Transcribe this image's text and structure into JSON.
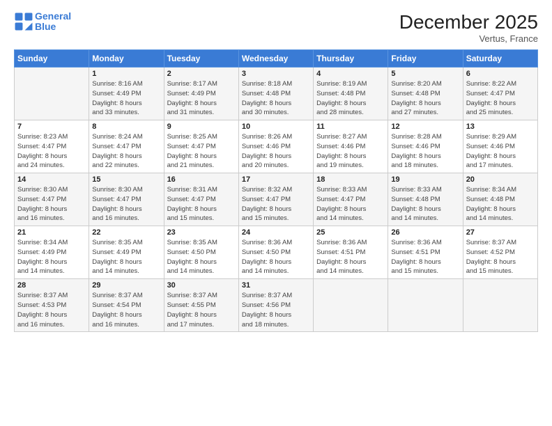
{
  "logo": {
    "line1": "General",
    "line2": "Blue"
  },
  "title": "December 2025",
  "location": "Vertus, France",
  "headers": [
    "Sunday",
    "Monday",
    "Tuesday",
    "Wednesday",
    "Thursday",
    "Friday",
    "Saturday"
  ],
  "weeks": [
    [
      {
        "day": "",
        "info": ""
      },
      {
        "day": "1",
        "info": "Sunrise: 8:16 AM\nSunset: 4:49 PM\nDaylight: 8 hours\nand 33 minutes."
      },
      {
        "day": "2",
        "info": "Sunrise: 8:17 AM\nSunset: 4:49 PM\nDaylight: 8 hours\nand 31 minutes."
      },
      {
        "day": "3",
        "info": "Sunrise: 8:18 AM\nSunset: 4:48 PM\nDaylight: 8 hours\nand 30 minutes."
      },
      {
        "day": "4",
        "info": "Sunrise: 8:19 AM\nSunset: 4:48 PM\nDaylight: 8 hours\nand 28 minutes."
      },
      {
        "day": "5",
        "info": "Sunrise: 8:20 AM\nSunset: 4:48 PM\nDaylight: 8 hours\nand 27 minutes."
      },
      {
        "day": "6",
        "info": "Sunrise: 8:22 AM\nSunset: 4:47 PM\nDaylight: 8 hours\nand 25 minutes."
      }
    ],
    [
      {
        "day": "7",
        "info": "Sunrise: 8:23 AM\nSunset: 4:47 PM\nDaylight: 8 hours\nand 24 minutes."
      },
      {
        "day": "8",
        "info": "Sunrise: 8:24 AM\nSunset: 4:47 PM\nDaylight: 8 hours\nand 22 minutes."
      },
      {
        "day": "9",
        "info": "Sunrise: 8:25 AM\nSunset: 4:47 PM\nDaylight: 8 hours\nand 21 minutes."
      },
      {
        "day": "10",
        "info": "Sunrise: 8:26 AM\nSunset: 4:46 PM\nDaylight: 8 hours\nand 20 minutes."
      },
      {
        "day": "11",
        "info": "Sunrise: 8:27 AM\nSunset: 4:46 PM\nDaylight: 8 hours\nand 19 minutes."
      },
      {
        "day": "12",
        "info": "Sunrise: 8:28 AM\nSunset: 4:46 PM\nDaylight: 8 hours\nand 18 minutes."
      },
      {
        "day": "13",
        "info": "Sunrise: 8:29 AM\nSunset: 4:46 PM\nDaylight: 8 hours\nand 17 minutes."
      }
    ],
    [
      {
        "day": "14",
        "info": "Sunrise: 8:30 AM\nSunset: 4:47 PM\nDaylight: 8 hours\nand 16 minutes."
      },
      {
        "day": "15",
        "info": "Sunrise: 8:30 AM\nSunset: 4:47 PM\nDaylight: 8 hours\nand 16 minutes."
      },
      {
        "day": "16",
        "info": "Sunrise: 8:31 AM\nSunset: 4:47 PM\nDaylight: 8 hours\nand 15 minutes."
      },
      {
        "day": "17",
        "info": "Sunrise: 8:32 AM\nSunset: 4:47 PM\nDaylight: 8 hours\nand 15 minutes."
      },
      {
        "day": "18",
        "info": "Sunrise: 8:33 AM\nSunset: 4:47 PM\nDaylight: 8 hours\nand 14 minutes."
      },
      {
        "day": "19",
        "info": "Sunrise: 8:33 AM\nSunset: 4:48 PM\nDaylight: 8 hours\nand 14 minutes."
      },
      {
        "day": "20",
        "info": "Sunrise: 8:34 AM\nSunset: 4:48 PM\nDaylight: 8 hours\nand 14 minutes."
      }
    ],
    [
      {
        "day": "21",
        "info": "Sunrise: 8:34 AM\nSunset: 4:49 PM\nDaylight: 8 hours\nand 14 minutes."
      },
      {
        "day": "22",
        "info": "Sunrise: 8:35 AM\nSunset: 4:49 PM\nDaylight: 8 hours\nand 14 minutes."
      },
      {
        "day": "23",
        "info": "Sunrise: 8:35 AM\nSunset: 4:50 PM\nDaylight: 8 hours\nand 14 minutes."
      },
      {
        "day": "24",
        "info": "Sunrise: 8:36 AM\nSunset: 4:50 PM\nDaylight: 8 hours\nand 14 minutes."
      },
      {
        "day": "25",
        "info": "Sunrise: 8:36 AM\nSunset: 4:51 PM\nDaylight: 8 hours\nand 14 minutes."
      },
      {
        "day": "26",
        "info": "Sunrise: 8:36 AM\nSunset: 4:51 PM\nDaylight: 8 hours\nand 15 minutes."
      },
      {
        "day": "27",
        "info": "Sunrise: 8:37 AM\nSunset: 4:52 PM\nDaylight: 8 hours\nand 15 minutes."
      }
    ],
    [
      {
        "day": "28",
        "info": "Sunrise: 8:37 AM\nSunset: 4:53 PM\nDaylight: 8 hours\nand 16 minutes."
      },
      {
        "day": "29",
        "info": "Sunrise: 8:37 AM\nSunset: 4:54 PM\nDaylight: 8 hours\nand 16 minutes."
      },
      {
        "day": "30",
        "info": "Sunrise: 8:37 AM\nSunset: 4:55 PM\nDaylight: 8 hours\nand 17 minutes."
      },
      {
        "day": "31",
        "info": "Sunrise: 8:37 AM\nSunset: 4:56 PM\nDaylight: 8 hours\nand 18 minutes."
      },
      {
        "day": "",
        "info": ""
      },
      {
        "day": "",
        "info": ""
      },
      {
        "day": "",
        "info": ""
      }
    ]
  ]
}
